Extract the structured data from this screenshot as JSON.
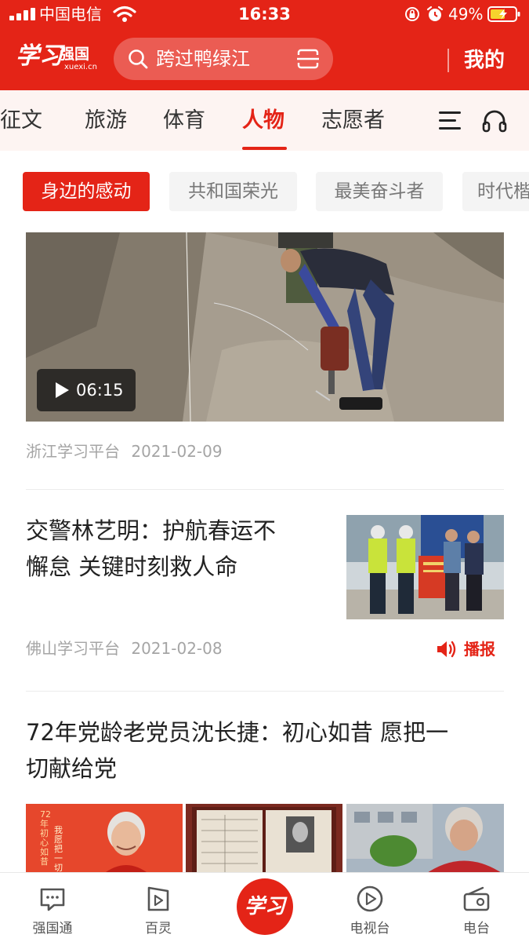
{
  "status_bar": {
    "carrier": "中国电信",
    "time": "16:33",
    "battery": "49%"
  },
  "header": {
    "logo_script": "学习",
    "logo_name": "强国",
    "logo_domain": "xuexi.cn",
    "search_query": "跨过鸭绿江",
    "mine_label": "我的"
  },
  "channels": {
    "tabs": [
      {
        "label": "征文",
        "active": false
      },
      {
        "label": "旅游",
        "active": false
      },
      {
        "label": "体育",
        "active": false
      },
      {
        "label": "人物",
        "active": true
      },
      {
        "label": "志愿者",
        "active": false
      }
    ]
  },
  "subtabs": [
    {
      "label": "身边的感动",
      "active": true
    },
    {
      "label": "共和国荣光",
      "active": false
    },
    {
      "label": "最美奋斗者",
      "active": false
    },
    {
      "label": "时代楷",
      "active": false
    }
  ],
  "articles": [
    {
      "type": "video",
      "duration": "06:15",
      "source": "浙江学习平台",
      "date": "2021-02-09"
    },
    {
      "type": "text-thumb",
      "title_line1": "交警林艺明：护航春运不",
      "title_line2": "懈怠 关键时刻救人命",
      "source": "佛山学习平台",
      "date": "2021-02-08",
      "broadcast_label": "播报"
    },
    {
      "type": "gallery",
      "title_line1": "72年党龄老党员沈长捷：初心如昔 愿把一",
      "title_line2": "切献给党",
      "poster_text": "72年初心如昔",
      "poster_text2": "我愿把一切"
    }
  ],
  "bottom_nav": [
    {
      "label": "强国通",
      "icon": "chat-icon"
    },
    {
      "label": "百灵",
      "icon": "video-play-icon"
    },
    {
      "label": "学习",
      "icon": "study-logo-icon"
    },
    {
      "label": "电视台",
      "icon": "tv-play-icon"
    },
    {
      "label": "电台",
      "icon": "radio-icon"
    }
  ],
  "colors": {
    "brand_red": "#e42417",
    "tab_bg": "#fdf4f2",
    "text_dark": "#222222",
    "meta_gray": "#a5a5a5"
  }
}
